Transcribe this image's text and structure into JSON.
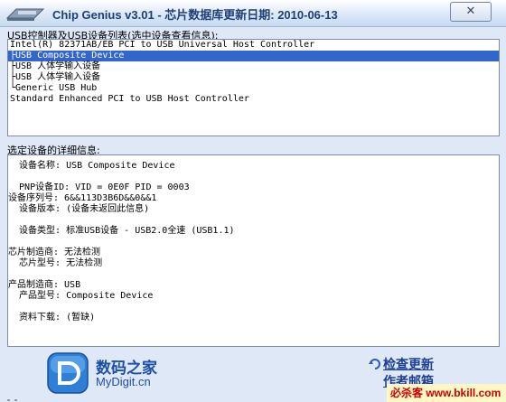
{
  "window": {
    "title": "Chip Genius v3.01 - 芯片数据库更新日期: 2010-06-13",
    "close_glyph": "✕"
  },
  "device_list": {
    "label": "USB控制器及USB设备列表(选中设备查看信息):",
    "items": [
      "Intel(R) 82371AB/EB PCI to USB Universal Host Controller",
      "├USB Composite Device",
      "├USB 人体学输入设备",
      "├USB 人体学输入设备",
      "└Generic USB Hub",
      "Standard Enhanced PCI to USB Host Controller"
    ],
    "selected_index": 1
  },
  "details": {
    "label": "选定设备的详细信息:",
    "lines": [
      "  设备名称: USB Composite Device",
      "",
      "  PNP设备ID: VID = 0E0F PID = 0003",
      "设备序列号: 6&&113D3B6D&&0&&1",
      "  设备版本: (设备未返回此信息)",
      "",
      "  设备类型: 标准USB设备 - USB2.0全速 (USB1.1)",
      "",
      "芯片制造商: 无法检测",
      "  芯片型号: 无法检测",
      "",
      "产品制造商: USB",
      "  产品型号: Composite Device",
      "",
      "  资料下载: (暂缺)"
    ]
  },
  "footer": {
    "logo_cn": "数码之家",
    "logo_en": "MyDigit.cn",
    "check_update": "检查更新",
    "author_mail": "作者邮箱",
    "watermark": "必杀客 www.bkill.com"
  },
  "colors": {
    "selection": "#3366cc",
    "link": "#1b3f94",
    "brand": "#1b4fa8"
  },
  "icons": [
    "app-icon",
    "close-icon",
    "mydigit-logo-icon",
    "update-arrow-icon"
  ]
}
